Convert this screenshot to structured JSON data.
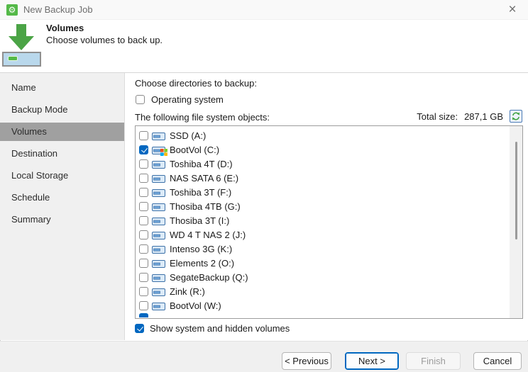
{
  "window": {
    "title": "New Backup Job",
    "app_icon": "⚙",
    "close_icon": "×"
  },
  "header": {
    "title": "Volumes",
    "subtitle": "Choose volumes to back up."
  },
  "sidebar": {
    "items": [
      {
        "label": "Name",
        "selected": false
      },
      {
        "label": "Backup Mode",
        "selected": false
      },
      {
        "label": "Volumes",
        "selected": true
      },
      {
        "label": "Destination",
        "selected": false
      },
      {
        "label": "Local Storage",
        "selected": false
      },
      {
        "label": "Schedule",
        "selected": false
      },
      {
        "label": "Summary",
        "selected": false
      }
    ]
  },
  "content": {
    "section_label": "Choose directories to backup:",
    "os_checkbox": {
      "label": "Operating system",
      "checked": false
    },
    "list_label": "The following file system objects:",
    "total_size_label": "Total size:",
    "total_size_value": "287,1 GB",
    "volumes": [
      {
        "label": "SSD (A:)",
        "checked": false,
        "windows": false
      },
      {
        "label": "BootVol (C:)",
        "checked": true,
        "windows": true
      },
      {
        "label": "Toshiba 4T (D:)",
        "checked": false,
        "windows": false
      },
      {
        "label": "NAS SATA 6 (E:)",
        "checked": false,
        "windows": false
      },
      {
        "label": "Toshiba 3T (F:)",
        "checked": false,
        "windows": false
      },
      {
        "label": "Thosiba 4TB (G:)",
        "checked": false,
        "windows": false
      },
      {
        "label": "Thosiba 3T (I:)",
        "checked": false,
        "windows": false
      },
      {
        "label": "WD 4 T NAS 2 (J:)",
        "checked": false,
        "windows": false
      },
      {
        "label": "Intenso 3G (K:)",
        "checked": false,
        "windows": false
      },
      {
        "label": "Elements 2 (O:)",
        "checked": false,
        "windows": false
      },
      {
        "label": "SegateBackup (Q:)",
        "checked": false,
        "windows": false
      },
      {
        "label": "Zink (R:)",
        "checked": false,
        "windows": false
      },
      {
        "label": "BootVol (W:)",
        "checked": false,
        "windows": false
      }
    ],
    "partial_row": {
      "visible": true,
      "checked": true
    },
    "show_hidden_checkbox": {
      "label": "Show system and hidden volumes",
      "checked": true
    }
  },
  "footer": {
    "buttons": [
      {
        "label": "< Previous",
        "state": "normal",
        "name": "previous-button"
      },
      {
        "label": "Next >",
        "state": "default",
        "name": "next-button"
      },
      {
        "label": "Finish",
        "state": "disabled",
        "name": "finish-button"
      },
      {
        "label": "Cancel",
        "state": "normal",
        "name": "cancel-button"
      }
    ]
  },
  "colors": {
    "accent_blue": "#0067c0",
    "veeam_green": "#54b948",
    "selected_step_gray": "#a0a0a0",
    "disk_icon_blue": "#3d71a8"
  }
}
